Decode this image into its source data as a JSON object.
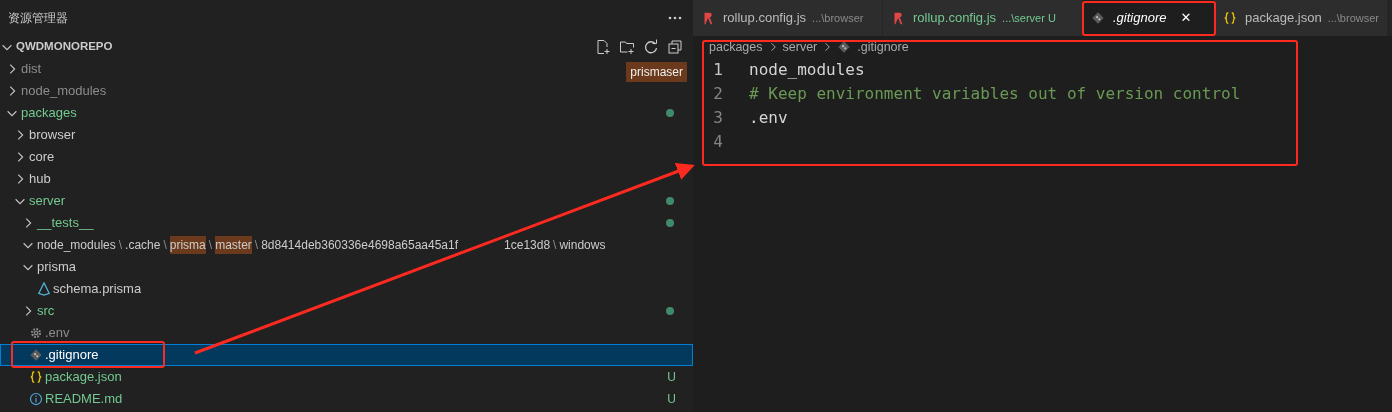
{
  "sidebar": {
    "title": "资源管理器",
    "root": {
      "label": "QWDMONOREPO",
      "expanded": true
    },
    "tooltip": "prismaser",
    "tree": [
      {
        "label": "dist",
        "kind": "folder",
        "expanded": false,
        "color": "#8c8c8c",
        "selected": false
      },
      {
        "label": "node_modules",
        "kind": "folder",
        "expanded": false,
        "color": "#8c8c8c",
        "selected": false
      },
      {
        "label": "packages",
        "kind": "folder",
        "expanded": true,
        "color": "#73c991",
        "dot": true,
        "selected": false,
        "children": [
          {
            "label": "browser",
            "kind": "folder",
            "expanded": false,
            "color": "#cccccc",
            "selected": false
          },
          {
            "label": "core",
            "kind": "folder",
            "expanded": false,
            "color": "#cccccc",
            "selected": false
          },
          {
            "label": "hub",
            "kind": "folder",
            "expanded": false,
            "color": "#cccccc",
            "selected": false
          },
          {
            "label": "server",
            "kind": "folder",
            "expanded": true,
            "color": "#73c991",
            "dot": true,
            "selected": false,
            "children": [
              {
                "label": "__tests__",
                "kind": "folder",
                "expanded": false,
                "color": "#73c991",
                "dot": true,
                "selected": false
              },
              {
                "kind": "path",
                "expanded": true,
                "color": "#cccccc",
                "selected": false,
                "separator": "\\",
                "segments": [
                  {
                    "text": "node_modules",
                    "highlight": false
                  },
                  {
                    "text": ".cache",
                    "highlight": false
                  },
                  {
                    "text": "prisma",
                    "highlight": true
                  },
                  {
                    "text": "master",
                    "highlight": true
                  },
                  {
                    "text": "8d8414deb360336e4698a65aa45a1f",
                    "highlight": false,
                    "gap_after": true
                  },
                  {
                    "text": "1ce13d8",
                    "highlight": false
                  },
                  {
                    "text": "windows",
                    "highlight": false
                  }
                ]
              },
              {
                "label": "prisma",
                "kind": "folder",
                "expanded": true,
                "color": "#cccccc",
                "selected": false,
                "children": [
                  {
                    "label": "schema.prisma",
                    "kind": "prisma",
                    "color": "#cccccc",
                    "selected": false
                  }
                ]
              },
              {
                "label": "src",
                "kind": "folder",
                "expanded": false,
                "color": "#73c991",
                "dot": true,
                "selected": false
              },
              {
                "label": ".env",
                "kind": "gear",
                "color": "#8c8c8c",
                "selected": false
              },
              {
                "label": ".gitignore",
                "kind": "git",
                "selected": true
              },
              {
                "label": "package.json",
                "kind": "braces",
                "color": "#73c991",
                "badge": "U",
                "selected": false
              },
              {
                "label": "README.md",
                "kind": "info",
                "color": "#73c991",
                "badge": "U",
                "selected": false
              }
            ]
          }
        ]
      }
    ]
  },
  "editor": {
    "tabs": [
      {
        "label": "rollup.config.js",
        "path": "...\\browser",
        "kind": "rollup",
        "color": "#bbbbbb",
        "selected": false
      },
      {
        "label": "rollup.config.js",
        "path": "...\\server",
        "badge": "U",
        "kind": "rollup",
        "color": "#73c991",
        "selected": false
      },
      {
        "label": ".gitignore",
        "kind": "git",
        "color": "#ffffff",
        "selected": true,
        "close": "✕"
      },
      {
        "label": "package.json",
        "path": "...\\browser",
        "kind": "braces",
        "color": "#bbbbbb",
        "selected": false
      }
    ],
    "breadcrumbs": [
      "packages",
      "server",
      ".gitignore"
    ],
    "lines": [
      {
        "number": "1",
        "text": "node_modules",
        "kind": "plain"
      },
      {
        "number": "2",
        "text": "# Keep environment variables out of version control",
        "kind": "comment"
      },
      {
        "number": "3",
        "text": ".env",
        "kind": "plain"
      },
      {
        "number": "4",
        "kind": "plain"
      }
    ]
  }
}
